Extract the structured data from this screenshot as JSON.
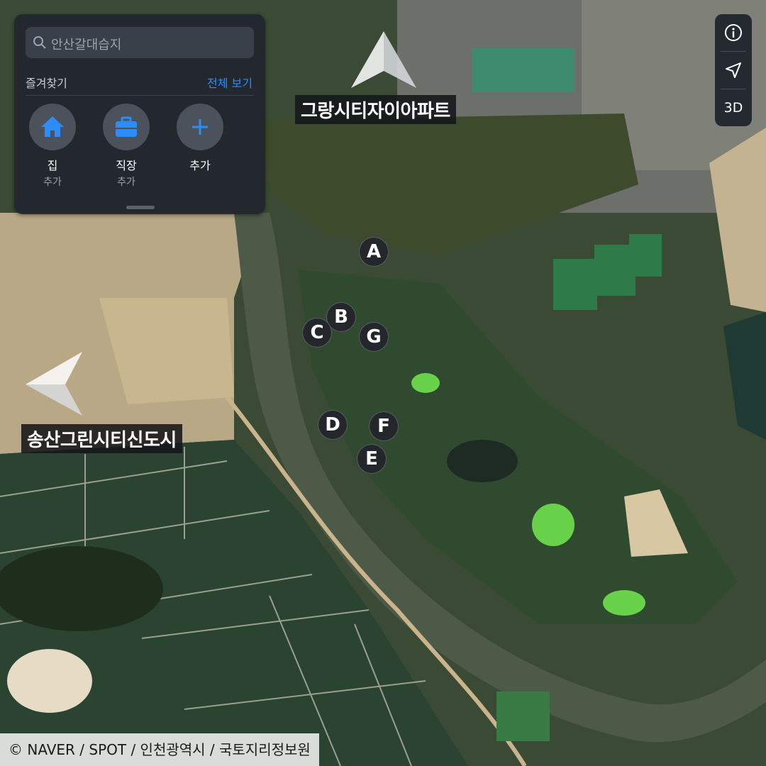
{
  "search": {
    "placeholder": "안산갈대습지"
  },
  "favorites": {
    "title": "즐겨찾기",
    "view_all": "전체 보기",
    "items": [
      {
        "label": "집",
        "sub": "추가",
        "icon": "home-icon"
      },
      {
        "label": "직장",
        "sub": "추가",
        "icon": "briefcase-icon"
      },
      {
        "label": "추가",
        "sub": "",
        "icon": "plus-icon"
      }
    ]
  },
  "map_controls": {
    "info_icon": "info-icon",
    "location_icon": "location-arrow-icon",
    "three_d": "3D"
  },
  "poi_labels": {
    "north": "그랑시티자이아파트",
    "west": "송산그린시티신도시"
  },
  "markers": [
    "A",
    "B",
    "C",
    "G",
    "D",
    "F",
    "E"
  ],
  "copyright": "© NAVER / SPOT / 인천광역시 / 국토지리정보원",
  "colors": {
    "accent": "#2d8cf6",
    "panel": "#21262e",
    "water": "#4e5a48",
    "paddy": "#2e4a34"
  }
}
